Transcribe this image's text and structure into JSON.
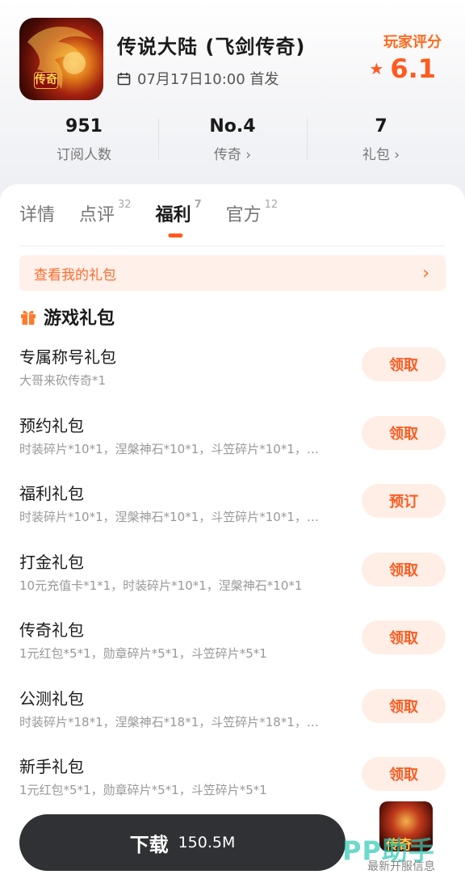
{
  "app": {
    "icon_text": "传奇",
    "title": "传说大陆 (飞剑传奇)",
    "release": "07月17日10:00 首发",
    "rating_label": "玩家评分",
    "rating_value": "6.1"
  },
  "stats": [
    {
      "value": "951",
      "label": "订阅人数"
    },
    {
      "value": "No.4",
      "label": "传奇 ›"
    },
    {
      "value": "7",
      "label": "礼包 ›"
    }
  ],
  "tabs": [
    {
      "label": "详情",
      "count": ""
    },
    {
      "label": "点评",
      "count": "32"
    },
    {
      "label": "福利",
      "count": "7"
    },
    {
      "label": "官方",
      "count": "12"
    }
  ],
  "my_gift": {
    "label": "查看我的礼包",
    "arrow": "›"
  },
  "section": {
    "title": "游戏礼包"
  },
  "gifts": [
    {
      "name": "专属称号礼包",
      "desc": "大哥来砍传奇*1",
      "button": "领取"
    },
    {
      "name": "预约礼包",
      "desc": "时装碎片*10*1，涅槃神石*10*1，斗笠碎片*10*1，…",
      "button": "领取"
    },
    {
      "name": "福利礼包",
      "desc": "时装碎片*10*1，涅槃神石*10*1，斗笠碎片*10*1，…",
      "button": "预订"
    },
    {
      "name": "打金礼包",
      "desc": "10元充值卡*1*1，时装碎片*10*1，涅槃神石*10*1",
      "button": "领取"
    },
    {
      "name": "传奇礼包",
      "desc": "1元红包*5*1，勋章碎片*5*1，斗笠碎片*5*1",
      "button": "领取"
    },
    {
      "name": "公测礼包",
      "desc": "时装碎片*18*1，涅槃神石*18*1，斗笠碎片*18*1，…",
      "button": "领取"
    },
    {
      "name": "新手礼包",
      "desc": "1元红包*5*1，勋章碎片*5*1，斗笠碎片*5*1",
      "button": "领取"
    }
  ],
  "download": {
    "label": "下载",
    "size": "150.5M"
  },
  "floating_ad": {
    "text": "传奇"
  },
  "watermark": "PP助手",
  "footer_note": "最新开服信息",
  "colors": {
    "accent": "#ff5a1f",
    "button_bg": "#ffeee6",
    "download_bg": "#2f3134"
  }
}
